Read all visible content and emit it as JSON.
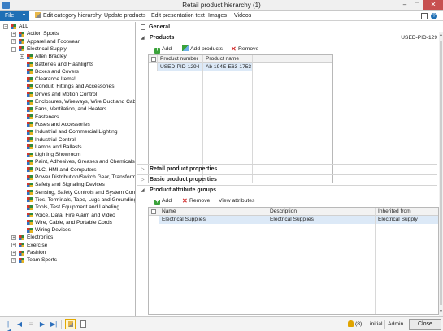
{
  "window": {
    "title": "Retail product hierarchy (1)",
    "min": "–",
    "max": "□",
    "close": "✕"
  },
  "ribbon": {
    "file_label": "File",
    "file_caret": "▾",
    "items": [
      "Edit category hierarchy",
      "Update products",
      "Edit presentation text",
      "Images",
      "Videos"
    ],
    "help": "?"
  },
  "tree": {
    "root": "ALL",
    "nodes": [
      {
        "label": "Action Sports",
        "exp": "+"
      },
      {
        "label": "Apparel and Footwear",
        "exp": "+"
      },
      {
        "label": "Electrical Supply",
        "exp": "−"
      },
      {
        "label": "Allen Bradley",
        "exp": "+"
      },
      {
        "label": "Batteries and Flashlights",
        "exp": ""
      },
      {
        "label": "Boxes and Covers",
        "exp": ""
      },
      {
        "label": "Clearance Items!",
        "exp": ""
      },
      {
        "label": "Conduit, Fittings and Accessories",
        "exp": ""
      },
      {
        "label": "Drives and Motion Control",
        "exp": ""
      },
      {
        "label": "Enclosures, Wireways, Wire Duct and Cable",
        "exp": ""
      },
      {
        "label": "Fans, Ventilation, and Heaters",
        "exp": ""
      },
      {
        "label": "Fasteners",
        "exp": ""
      },
      {
        "label": "Fuses and Accessories",
        "exp": ""
      },
      {
        "label": "Industrial and Commercial Lighting",
        "exp": ""
      },
      {
        "label": "Industrial Control",
        "exp": ""
      },
      {
        "label": "Lamps and Ballasts",
        "exp": ""
      },
      {
        "label": "Lighting Showroom",
        "exp": ""
      },
      {
        "label": "Paint, Adhesives, Greases and Chemicals",
        "exp": ""
      },
      {
        "label": "PLC, HMI and Computers",
        "exp": ""
      },
      {
        "label": "Power Distribution/Switch Gear, Transforme",
        "exp": ""
      },
      {
        "label": "Safety and Signaling Devices",
        "exp": ""
      },
      {
        "label": "Sensing, Safety Controls and System Conne",
        "exp": ""
      },
      {
        "label": "Ties, Terminals, Tape, Lugs and Grounding",
        "exp": ""
      },
      {
        "label": "Tools, Test Equipment and Labeling",
        "exp": ""
      },
      {
        "label": "Voice, Data, Fire Alarm and Video",
        "exp": ""
      },
      {
        "label": "Wire, Cable, and Portable Cords",
        "exp": ""
      },
      {
        "label": "Wiring Devices",
        "exp": ""
      },
      {
        "label": "Electronics",
        "exp": "+"
      },
      {
        "label": "Exercise",
        "exp": "+"
      },
      {
        "label": "Fashion",
        "exp": "+"
      },
      {
        "label": "Team Sports",
        "exp": "+"
      }
    ],
    "scroll_left": "<",
    "scroll_right": ">"
  },
  "general": {
    "label": "General"
  },
  "products": {
    "label": "Products",
    "current_id": "USED-PID-129",
    "toolbar": {
      "add": "Add",
      "add_products": "Add products",
      "remove": "Remove"
    },
    "columns": [
      "Product number",
      "Product name"
    ],
    "rows": [
      {
        "number": "USED-PID-1294",
        "name": "Ab 194E-E63-1753"
      }
    ]
  },
  "retail_props": {
    "label": "Retail product properties"
  },
  "basic_props": {
    "label": "Basic product properties"
  },
  "attr_groups": {
    "label": "Product attribute groups",
    "toolbar": {
      "add": "Add",
      "remove": "Remove",
      "view": "View attributes"
    },
    "columns": [
      "Name",
      "Description",
      "Inherited from"
    ],
    "rows": [
      {
        "name": "Electrical Supplies",
        "description": "Electrical Supplies",
        "inherited": "Electrical Supply"
      }
    ]
  },
  "statusbar": {
    "nav": [
      "|◀",
      "◀",
      "▶",
      "▶|"
    ],
    "alerts": "(8)",
    "status": "initial",
    "user": "Admin",
    "close": "Close"
  },
  "colors": {
    "accent": "#1f6fb5",
    "close_red": "#c75050",
    "selection": "#dce9f7"
  }
}
